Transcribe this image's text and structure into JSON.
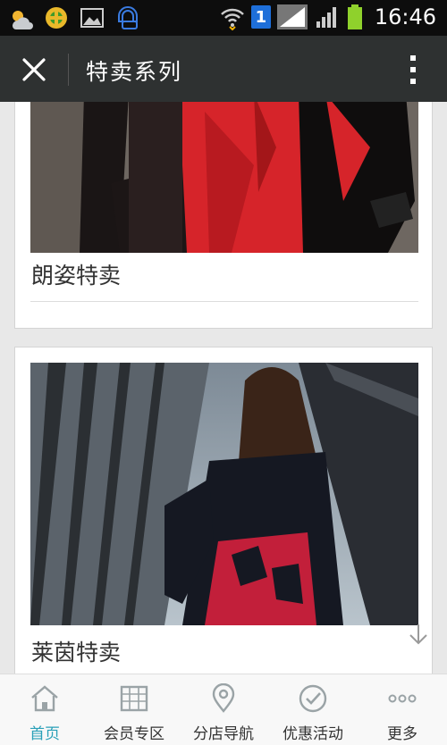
{
  "status_bar": {
    "time": "16:46",
    "notification_badge": "1",
    "icons": [
      "weather-icon",
      "app-icon",
      "image-icon",
      "chat-icon",
      "wifi-icon",
      "signal-icon",
      "battery-icon"
    ]
  },
  "app_bar": {
    "title": "特卖系列",
    "close_icon": "close-icon",
    "more_icon": "more-vertical-icon"
  },
  "cards": [
    {
      "title": "朗姿特卖",
      "image": "product-photo-red-coat"
    },
    {
      "title": "莱茵特卖",
      "image": "product-photo-black-dress"
    }
  ],
  "tabbar": {
    "tabs": [
      {
        "label": "首页",
        "icon": "home-icon",
        "active": true
      },
      {
        "label": "会员专区",
        "icon": "member-icon",
        "active": false
      },
      {
        "label": "分店导航",
        "icon": "location-icon",
        "active": false
      },
      {
        "label": "优惠活动",
        "icon": "check-icon",
        "active": false
      },
      {
        "label": "更多",
        "icon": "more-dots-icon",
        "active": false
      }
    ]
  },
  "colors": {
    "accent": "#2aa0b8",
    "app_bar": "#2e3131",
    "status_bar": "#0d0d0d"
  }
}
